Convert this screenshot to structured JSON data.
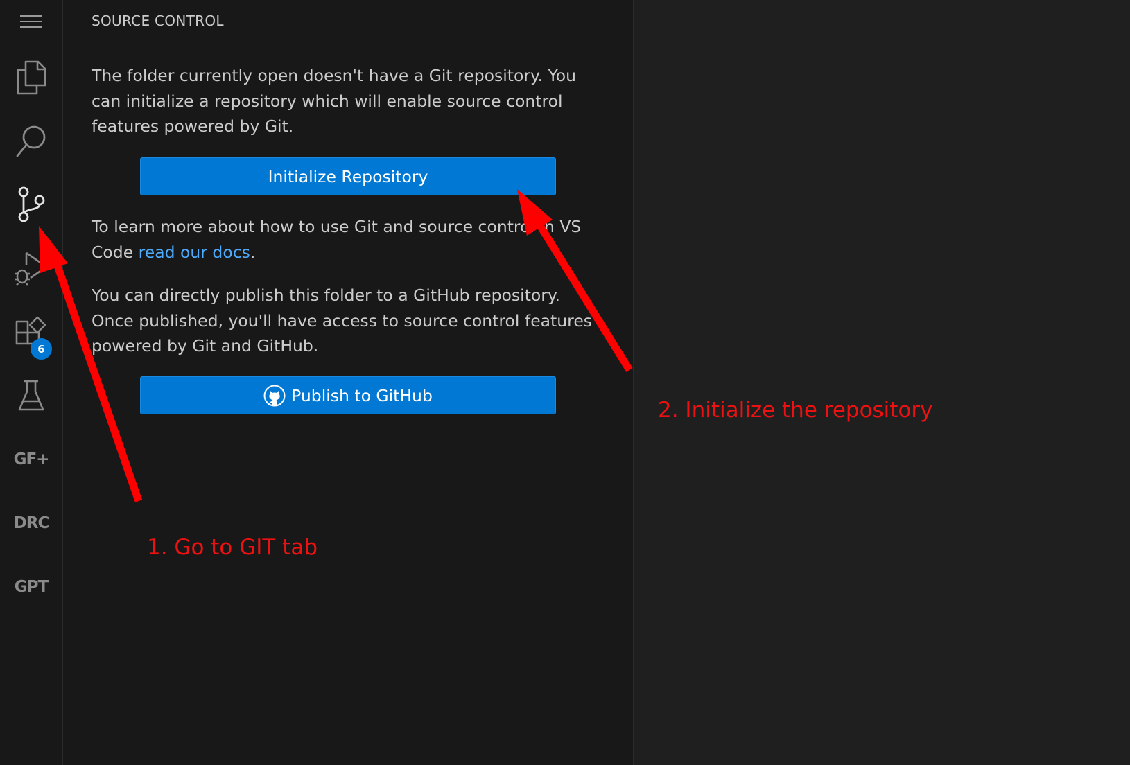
{
  "activity_bar": {
    "items": [
      {
        "name": "menu",
        "icon": "hamburger-menu-icon"
      },
      {
        "name": "explorer",
        "icon": "files-icon"
      },
      {
        "name": "search",
        "icon": "search-icon"
      },
      {
        "name": "source-control",
        "icon": "source-control-icon"
      },
      {
        "name": "run-debug",
        "icon": "run-debug-icon"
      },
      {
        "name": "extensions",
        "icon": "extensions-icon",
        "badge": "6"
      },
      {
        "name": "testing",
        "icon": "flask-icon"
      },
      {
        "name": "gf",
        "text": "GF+"
      },
      {
        "name": "drc",
        "text": "DRC"
      },
      {
        "name": "gpt",
        "text": "GPT"
      }
    ]
  },
  "panel": {
    "title": "SOURCE CONTROL",
    "intro": "The folder currently open doesn't have a Git repository. You can initialize a repository which will enable source control features powered by Git.",
    "init_button": "Initialize Repository",
    "learn_prefix": "To learn more about how to use Git and source control in VS Code ",
    "learn_link": "read our docs",
    "learn_suffix": ".",
    "publish_text": "You can directly publish this folder to a GitHub repository. Once published, you'll have access to source control features powered by Git and GitHub.",
    "publish_button": "Publish to GitHub"
  },
  "annotations": {
    "step1": "1. Go to GIT tab",
    "step2": "2. Initialize the repository",
    "arrow_color": "#ff0000"
  },
  "colors": {
    "accent": "#0078d4",
    "link": "#4daafc",
    "text": "#cccccc",
    "annotation": "#ee1111"
  }
}
